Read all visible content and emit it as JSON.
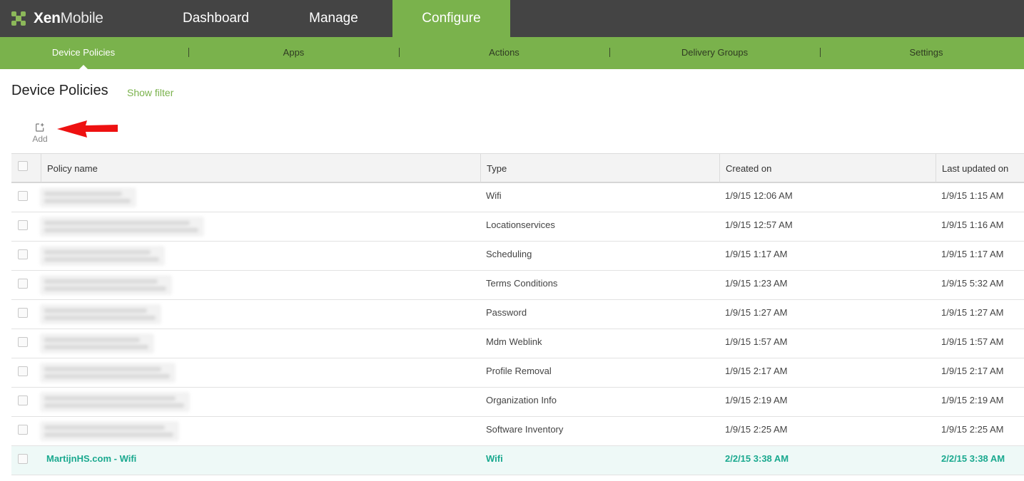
{
  "app": {
    "brand_bold": "Xen",
    "brand_thin": "Mobile"
  },
  "top_nav": {
    "tabs": [
      {
        "label": "Dashboard"
      },
      {
        "label": "Manage"
      },
      {
        "label": "Configure"
      }
    ],
    "active": "Configure"
  },
  "sub_nav": {
    "items": [
      {
        "label": "Device Policies"
      },
      {
        "label": "Apps"
      },
      {
        "label": "Actions"
      },
      {
        "label": "Delivery Groups"
      },
      {
        "label": "Settings"
      }
    ],
    "active": "Device Policies"
  },
  "page": {
    "title": "Device Policies",
    "show_filter": "Show filter",
    "add_label": "Add"
  },
  "table": {
    "columns": [
      "Policy name",
      "Type",
      "Created on",
      "Last updated on"
    ],
    "rows": [
      {
        "name": "",
        "type": "Wifi",
        "created": "1/9/15 12:06 AM",
        "updated": "1/9/15 1:15 AM"
      },
      {
        "name": "",
        "type": "Locationservices",
        "created": "1/9/15 12:57 AM",
        "updated": "1/9/15 1:16 AM"
      },
      {
        "name": "",
        "type": "Scheduling",
        "created": "1/9/15 1:17 AM",
        "updated": "1/9/15 1:17 AM"
      },
      {
        "name": "",
        "type": "Terms Conditions",
        "created": "1/9/15 1:23 AM",
        "updated": "1/9/15 5:32 AM"
      },
      {
        "name": "",
        "type": "Password",
        "created": "1/9/15 1:27 AM",
        "updated": "1/9/15 1:27 AM"
      },
      {
        "name": "",
        "type": "Mdm Weblink",
        "created": "1/9/15 1:57 AM",
        "updated": "1/9/15 1:57 AM"
      },
      {
        "name": "",
        "type": "Profile Removal",
        "created": "1/9/15 2:17 AM",
        "updated": "1/9/15 2:17 AM"
      },
      {
        "name": "",
        "type": "Organization Info",
        "created": "1/9/15 2:19 AM",
        "updated": "1/9/15 2:19 AM"
      },
      {
        "name": "",
        "type": "Software Inventory",
        "created": "1/9/15 2:25 AM",
        "updated": "1/9/15 2:25 AM"
      },
      {
        "name": "MartijnHS.com - Wifi",
        "type": "Wifi",
        "created": "2/2/15 3:38 AM",
        "updated": "2/2/15 3:38 AM"
      }
    ]
  },
  "colors": {
    "topbar": "#444444",
    "accent_green": "#7ab24c",
    "highlight_text": "#1aa98f",
    "highlight_row": "#eef9f7",
    "annotation_arrow": "#ee1111"
  }
}
